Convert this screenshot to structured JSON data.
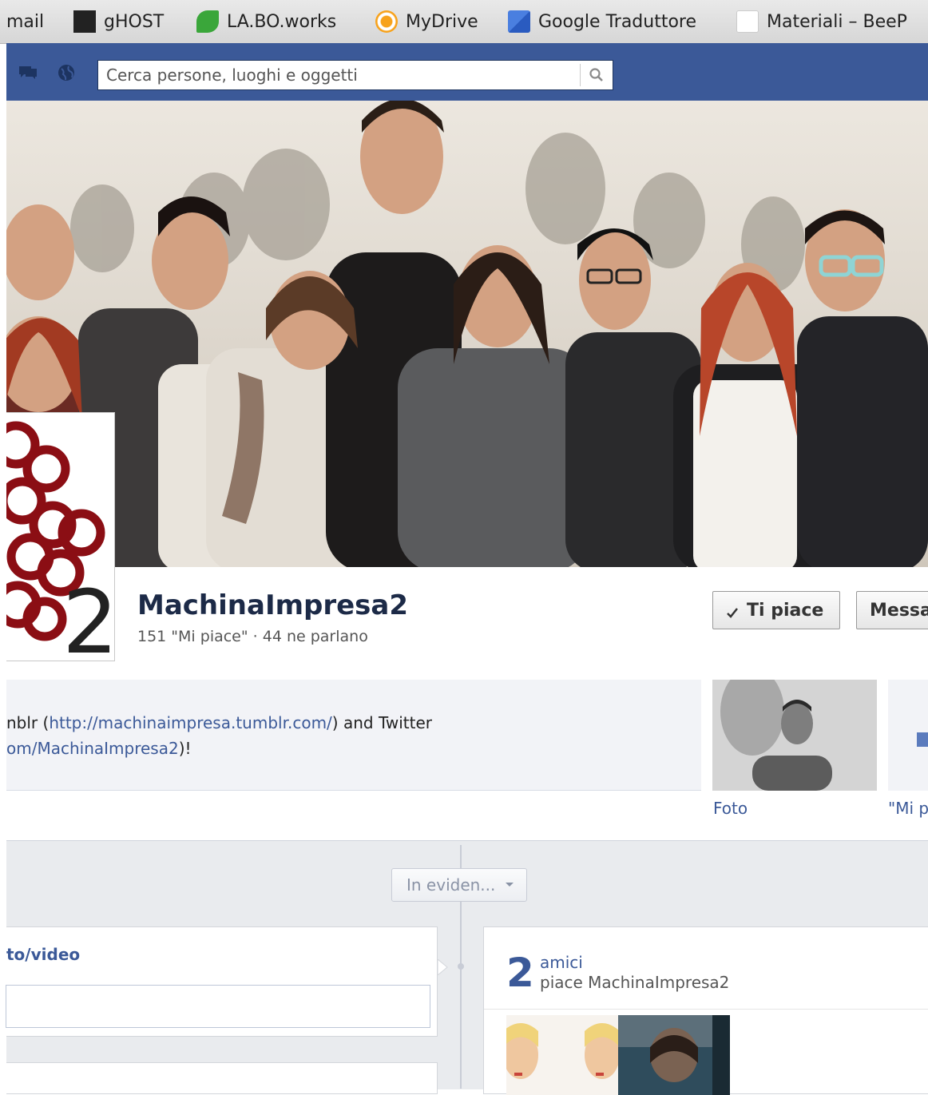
{
  "bookmarks": [
    {
      "label": "mail",
      "icon": "mail-icon"
    },
    {
      "label": "gHOST",
      "icon": "ghost-design-icon"
    },
    {
      "label": "LA.BO.works",
      "icon": "labo-leaf-icon"
    },
    {
      "label": "MyDrive",
      "icon": "mydrive-icon"
    },
    {
      "label": "Google Traduttore",
      "icon": "google-translate-icon"
    },
    {
      "label": "Materiali – BeeP",
      "icon": "beep-icon"
    }
  ],
  "search": {
    "placeholder": "Cerca persone, luoghi e oggetti"
  },
  "page": {
    "name": "MachinaImpresa2",
    "stats": "151 \"Mi piace\" · 44 ne parlano",
    "logo_text": "2"
  },
  "actions": {
    "like_label": "Ti piace",
    "message_label": "Messa"
  },
  "about": {
    "line1_prefix": "nblr (",
    "line1_link": "http://machinaimpresa.tumblr.com/",
    "line1_suffix": ") and Twitter",
    "line2_link": "om/MachinaImpresa2",
    "line2_suffix": ")!"
  },
  "thumbs": {
    "photo_label": "Foto",
    "likes_label": "\"Mi p"
  },
  "timeline": {
    "filter_label": "In eviden...",
    "left_card_title": "to/video",
    "friends_count": "2",
    "friends_label": "amici",
    "friends_text": "piace MachinaImpresa2"
  },
  "colors": {
    "facebook_blue": "#3b5998",
    "logo_red": "#8b0e14",
    "link": "#3b5998"
  }
}
